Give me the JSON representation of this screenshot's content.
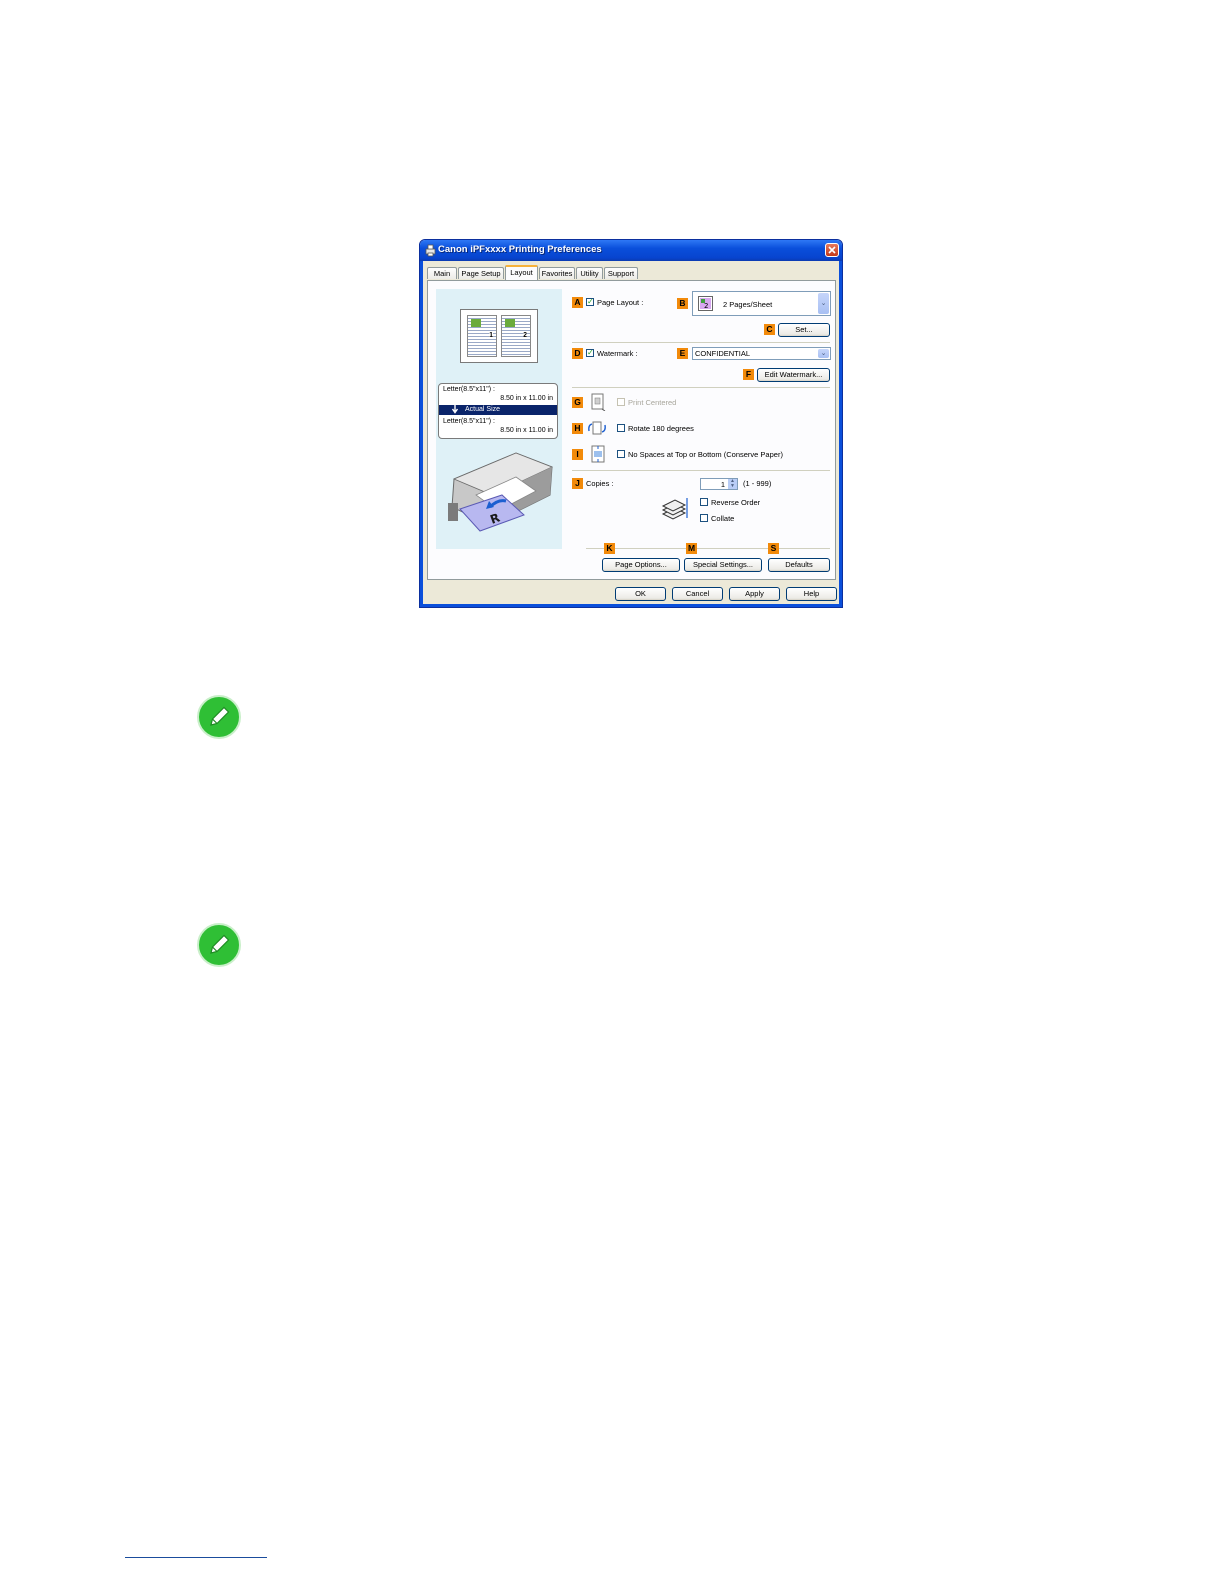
{
  "window": {
    "title": "Canon iPFxxxx Printing Preferences"
  },
  "tabs": [
    {
      "label": "Main"
    },
    {
      "label": "Page Setup"
    },
    {
      "label": "Layout"
    },
    {
      "label": "Favorites"
    },
    {
      "label": "Utility"
    },
    {
      "label": "Support"
    }
  ],
  "active_tab": "Layout",
  "preview": {
    "page_numbers": [
      "1",
      "2"
    ],
    "size_lines": [
      "Letter(8.5\"x11\") :",
      "8.50 in x 11.00 in",
      "Actual Size",
      "Letter(8.5\"x11\") :",
      "8.50 in x 11.00 in"
    ]
  },
  "callouts": {
    "A": "A",
    "B": "B",
    "C": "C",
    "D": "D",
    "E": "E",
    "F": "F",
    "G": "G",
    "H": "H",
    "I": "I",
    "J": "J",
    "K": "K",
    "M": "M",
    "S": "S"
  },
  "controls": {
    "page_layout_label": "Page Layout :",
    "page_layout_checked": true,
    "page_layout_value": "2 Pages/Sheet",
    "set_button": "Set...",
    "watermark_label": "Watermark :",
    "watermark_checked": true,
    "watermark_value": "CONFIDENTIAL",
    "edit_watermark_button": "Edit Watermark...",
    "print_centered_label": "Print Centered",
    "print_centered_enabled": false,
    "rotate_label": "Rotate 180 degrees",
    "no_spaces_label": "No Spaces at Top or Bottom (Conserve Paper)",
    "copies_label": "Copies :",
    "copies_value": "1",
    "copies_range": "(1 - 999)",
    "reverse_order_label": "Reverse Order",
    "collate_label": "Collate",
    "page_options_button": "Page Options...",
    "special_settings_button": "Special Settings...",
    "defaults_button": "Defaults"
  },
  "footer_buttons": {
    "ok": "OK",
    "cancel": "Cancel",
    "apply": "Apply",
    "help": "Help"
  },
  "colors": {
    "title_bar": "#0a4fdb",
    "callout": "#f28a0a",
    "note_icon": "#2fbf35"
  }
}
